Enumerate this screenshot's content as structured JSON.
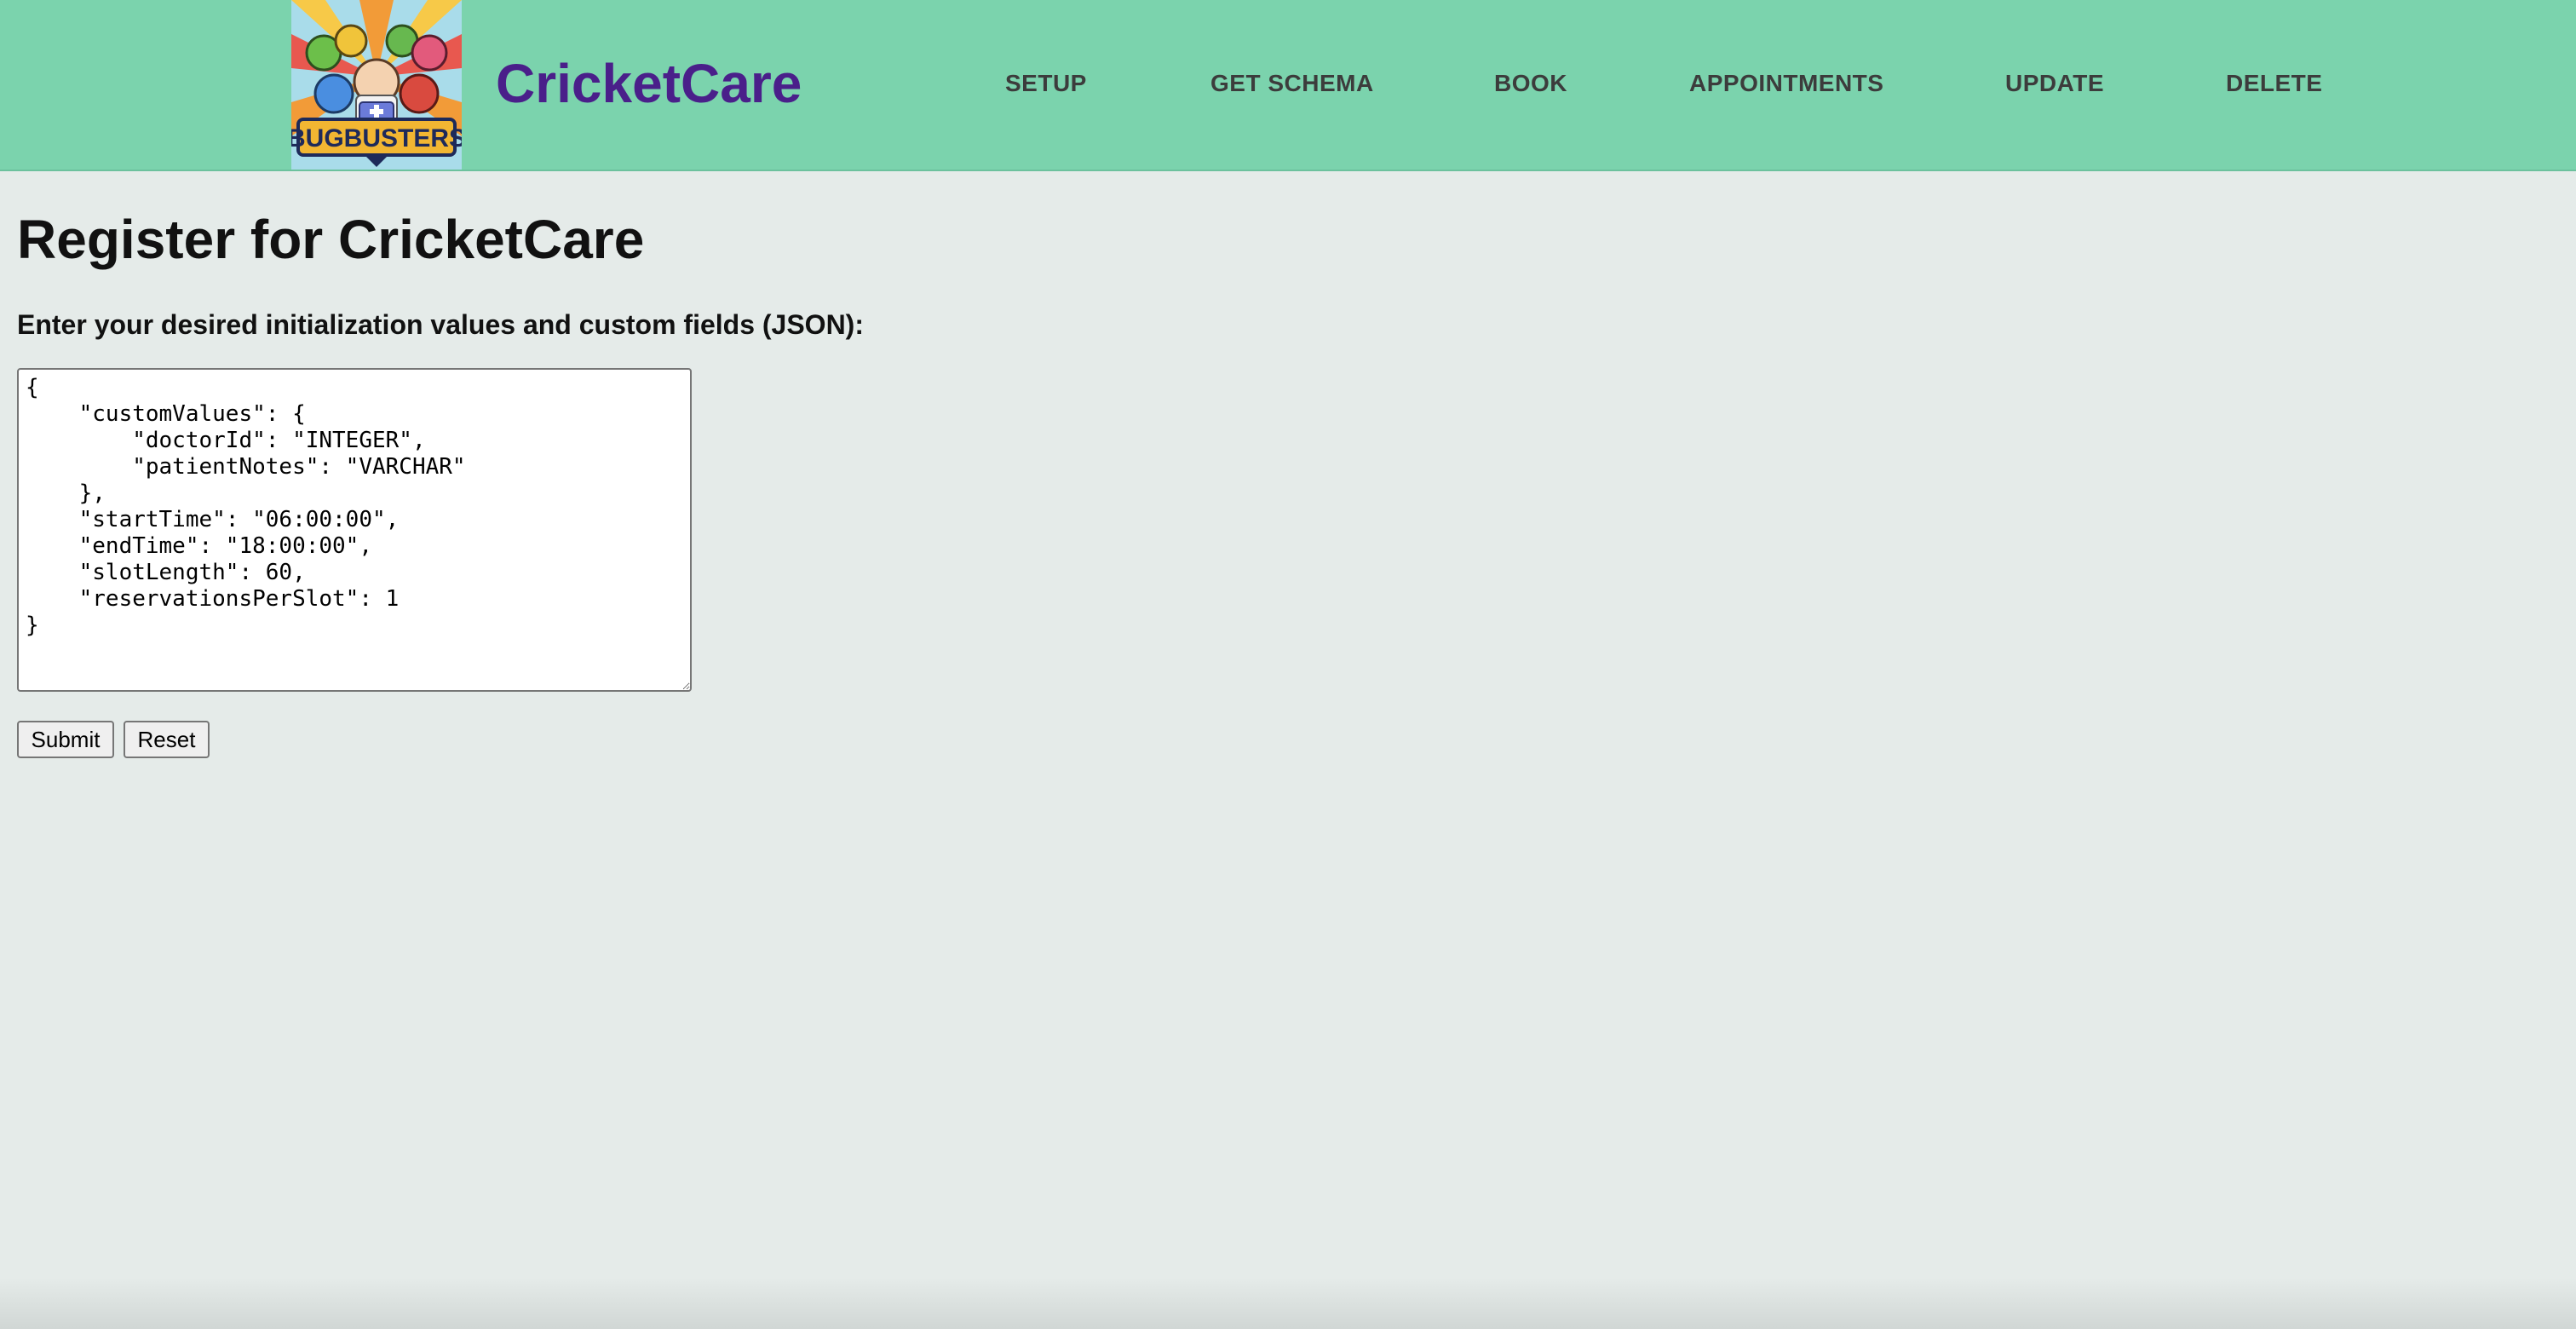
{
  "header": {
    "logo_text": "BUGBUSTERS",
    "brand": "CricketCare",
    "nav": [
      "SETUP",
      "GET SCHEMA",
      "BOOK",
      "APPOINTMENTS",
      "UPDATE",
      "DELETE"
    ]
  },
  "main": {
    "title": "Register for CricketCare",
    "prompt": "Enter your desired initialization values and custom fields (JSON):",
    "json_value": "{\n    \"customValues\": {\n        \"doctorId\": \"INTEGER\",\n        \"patientNotes\": \"VARCHAR\"\n    },\n    \"startTime\": \"06:00:00\",\n    \"endTime\": \"18:00:00\",\n    \"slotLength\": 60,\n    \"reservationsPerSlot\": 1\n}",
    "submit_label": "Submit",
    "reset_label": "Reset"
  },
  "colors": {
    "header_bg": "#7bd3ad",
    "brand": "#4a1f8a",
    "page_bg": "#e5ebe9"
  }
}
